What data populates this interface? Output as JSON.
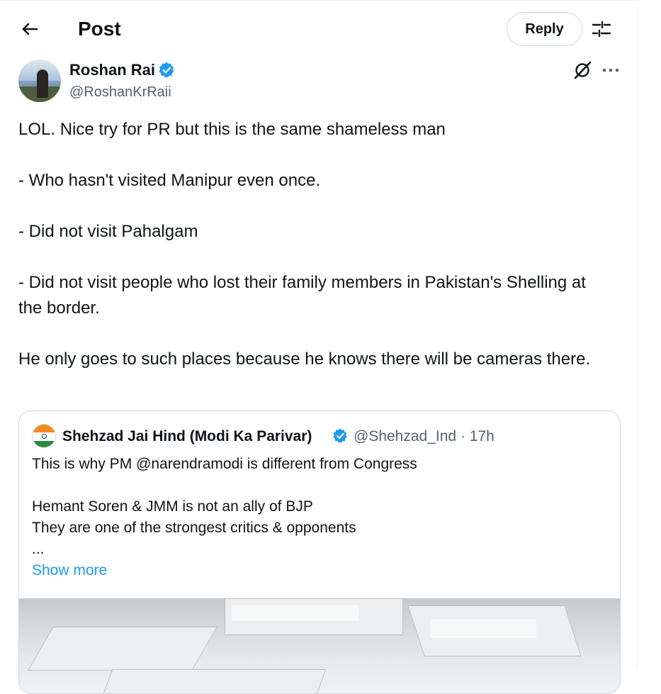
{
  "header": {
    "title": "Post",
    "reply_label": "Reply"
  },
  "post": {
    "author_name": "Roshan Rai",
    "author_handle": "@RoshanKrRaii",
    "paragraphs": [
      "LOL. Nice try for PR but this is the same shameless man",
      "- Who hasn't visited Manipur even once.",
      "- Did not visit Pahalgam",
      "- Did not visit people who lost their family members in Pakistan's Shelling at the border.",
      "He only goes to such places because he knows there will be cameras there."
    ]
  },
  "quoted": {
    "author_name": "Shehzad Jai Hind (Modi Ka Parivar)",
    "meta": "@Shehzad_Ind · 17h",
    "lines": [
      "This is why PM @narendramodi is different from Congress",
      "Hemant Soren & JMM is not an ally of BJP",
      "They are one of the strongest critics & opponents",
      "..."
    ],
    "show_more": "Show more"
  },
  "icons": {
    "back": "arrow-left-icon",
    "adjust": "sliders-icon",
    "verified": "verified-badge-icon",
    "grok": "grok-icon",
    "more": "more-horizontal-icon"
  },
  "colors": {
    "accent": "#1d9bf0",
    "secondary_text": "#536471",
    "border": "#cfd9de"
  }
}
